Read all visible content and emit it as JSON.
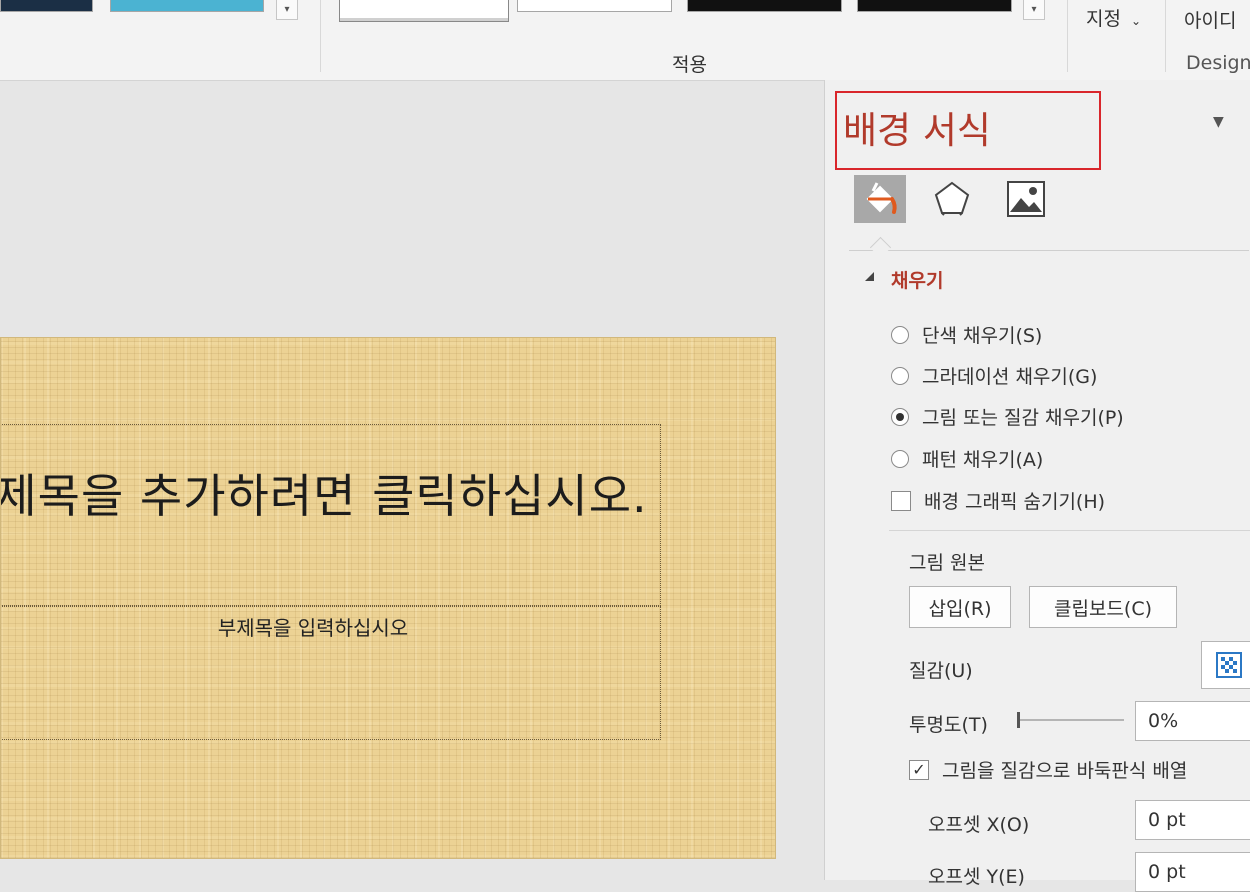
{
  "ribbon": {
    "apply_label": "적용",
    "customize_label": "지정",
    "customize_chevron": "chevron-down-icon",
    "ideas_label": "아이디",
    "designer_label": "Design",
    "more_icon": "chevron-down-icon"
  },
  "slide": {
    "title": "제목을 추가하려면 클릭하십시오.",
    "subtitle": "부제목을 입력하십시오"
  },
  "pane": {
    "title": "배경 서식",
    "menu_icon": "triangle-down-icon",
    "tabs": [
      {
        "name": "fill-tab",
        "icon": "paint-bucket-icon",
        "selected": true
      },
      {
        "name": "effects-tab",
        "icon": "pentagon-icon",
        "selected": false
      },
      {
        "name": "picture-tab",
        "icon": "picture-icon",
        "selected": false
      }
    ],
    "fill_section": {
      "header": "채우기",
      "options": [
        {
          "label": "단색 채우기(S)",
          "selected": false
        },
        {
          "label": "그라데이션 채우기(G)",
          "selected": false
        },
        {
          "label": "그림 또는 질감 채우기(P)",
          "selected": true
        },
        {
          "label": "패턴 채우기(A)",
          "selected": false
        }
      ],
      "hide_graphics_label": "배경 그래픽 숨기기(H)",
      "hide_graphics_checked": false,
      "picture_source_label": "그림 원본",
      "insert_button": "삽입(R)",
      "clipboard_button": "클립보드(C)",
      "texture_label": "질감(U)",
      "transparency_label": "투명도(T)",
      "transparency_value": "0%",
      "tile_label": "그림을 질감으로 바둑판식 배열",
      "tile_checked": true,
      "offset_x_label": "오프셋 X(O)",
      "offset_x_value": "0 pt",
      "offset_y_label": "오프셋 Y(E)",
      "offset_y_value": "0 pt"
    }
  },
  "colors": {
    "accent_red": "#b13a2b",
    "highlight_border": "#d9262b",
    "slide_background": "#ecd294"
  }
}
